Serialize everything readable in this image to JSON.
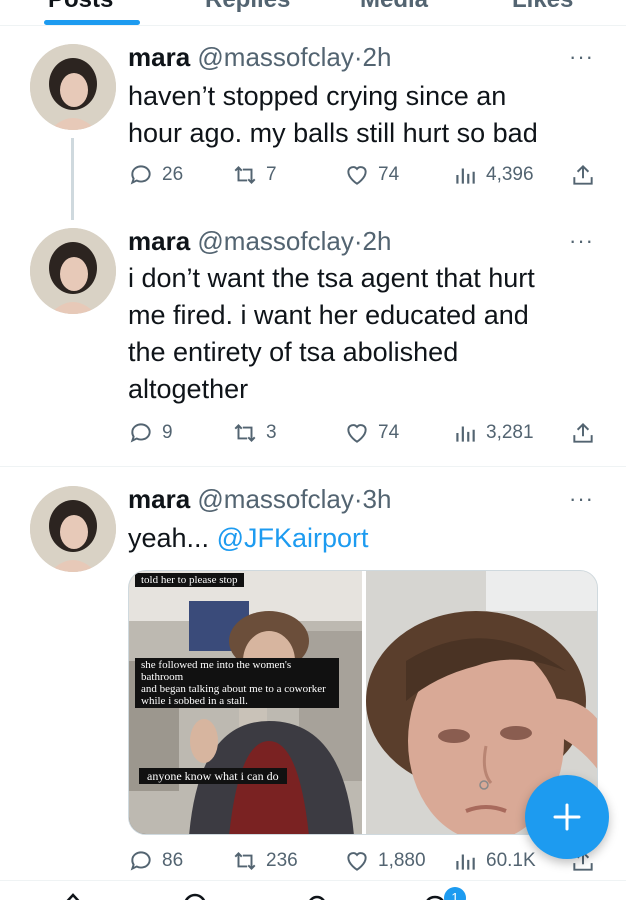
{
  "tabs": [
    {
      "label": "Posts"
    },
    {
      "label": "Replies"
    },
    {
      "label": "Media"
    },
    {
      "label": "Likes"
    }
  ],
  "tweets": [
    {
      "name": "mara",
      "handle": "@massofclay",
      "time": "2h",
      "text_lines": [
        "haven’t stopped crying since an",
        "hour ago. my balls still hurt so bad"
      ],
      "replies": "26",
      "retweets": "7",
      "likes": "74",
      "views": "4,396"
    },
    {
      "name": "mara",
      "handle": "@massofclay",
      "time": "2h",
      "text_lines": [
        "i don’t want the tsa agent that hurt",
        "me fired. i want her educated and",
        "the entirety of tsa abolished",
        "altogether"
      ],
      "replies": "9",
      "retweets": "3",
      "likes": "74",
      "views": "3,281"
    },
    {
      "name": "mara",
      "handle": "@massofclay",
      "time": "3h",
      "text_prefix": "yeah... ",
      "mention": "@JFKairport",
      "media_captions": [
        "told her to please stop",
        "she followed me into the women's bathroom",
        "and began talking about me to a coworker",
        "while i sobbed in a stall.",
        "anyone know what i can do"
      ],
      "replies": "86",
      "retweets": "236",
      "likes": "1,880",
      "views": "60.1K"
    }
  ],
  "separator": "·",
  "more_glyph": "···",
  "fab": {
    "icon": "plus-icon"
  },
  "bottom_nav": {
    "notification_count": "1"
  },
  "colors": {
    "accent": "#1d9bf0",
    "text": "#0f1419",
    "muted": "#536471",
    "border": "#eff3f4"
  }
}
